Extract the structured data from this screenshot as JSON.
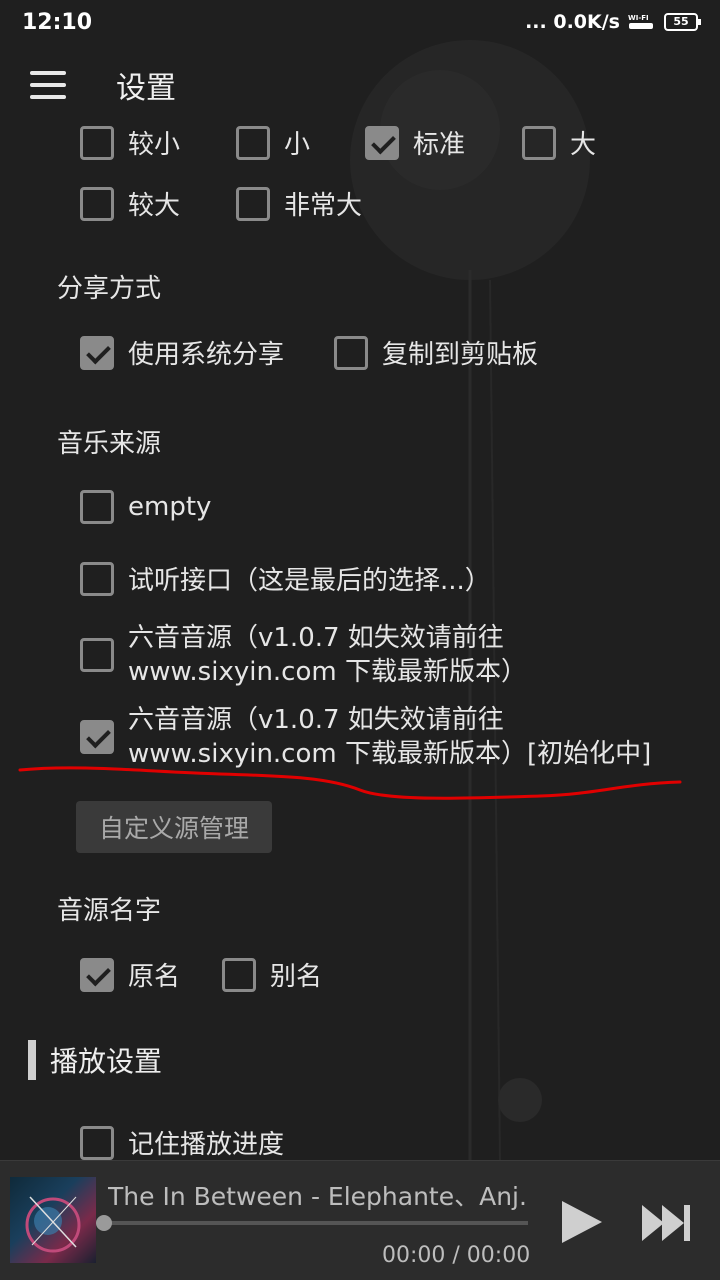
{
  "status": {
    "time": "12:10",
    "network": "... 0.0K/s",
    "wifi_label": "WI-FI",
    "battery": "55"
  },
  "header": {
    "title": "设置",
    "menu_icon": "hamburger-menu-icon"
  },
  "font_size": {
    "options": [
      {
        "label": "较小",
        "checked": false
      },
      {
        "label": "小",
        "checked": false
      },
      {
        "label": "标准",
        "checked": true
      },
      {
        "label": "大",
        "checked": false
      },
      {
        "label": "较大",
        "checked": false
      },
      {
        "label": "非常大",
        "checked": false
      }
    ]
  },
  "share": {
    "title": "分享方式",
    "options": [
      {
        "label": "使用系统分享",
        "checked": true
      },
      {
        "label": "复制到剪贴板",
        "checked": false
      }
    ]
  },
  "music_source": {
    "title": "音乐来源",
    "options": [
      {
        "line1": "empty",
        "line2": "",
        "checked": false
      },
      {
        "line1": "试听接口（这是最后的选择...）",
        "line2": "",
        "checked": false
      },
      {
        "line1": "六音音源（v1.0.7 如失效请前往",
        "line2": "www.sixyin.com 下载最新版本）",
        "checked": false
      },
      {
        "line1": "六音音源（v1.0.7 如失效请前往",
        "line2": "www.sixyin.com 下载最新版本）[初始化中]",
        "checked": true
      }
    ],
    "custom_button": "自定义源管理"
  },
  "source_name": {
    "title": "音源名字",
    "options": [
      {
        "label": "原名",
        "checked": true
      },
      {
        "label": "别名",
        "checked": false
      }
    ]
  },
  "playback": {
    "title": "播放设置",
    "options": [
      {
        "label": "记住播放进度",
        "checked": false
      }
    ]
  },
  "player": {
    "song": "The In Between - Elephante、Anj...",
    "time": "00:00 / 00:00",
    "progress": 0,
    "play_icon": "play-icon",
    "next_icon": "skip-next-icon"
  },
  "colors": {
    "background": "#1f1f1f",
    "checkbox": "#8a8a8a",
    "annotation_red": "#e00000"
  }
}
